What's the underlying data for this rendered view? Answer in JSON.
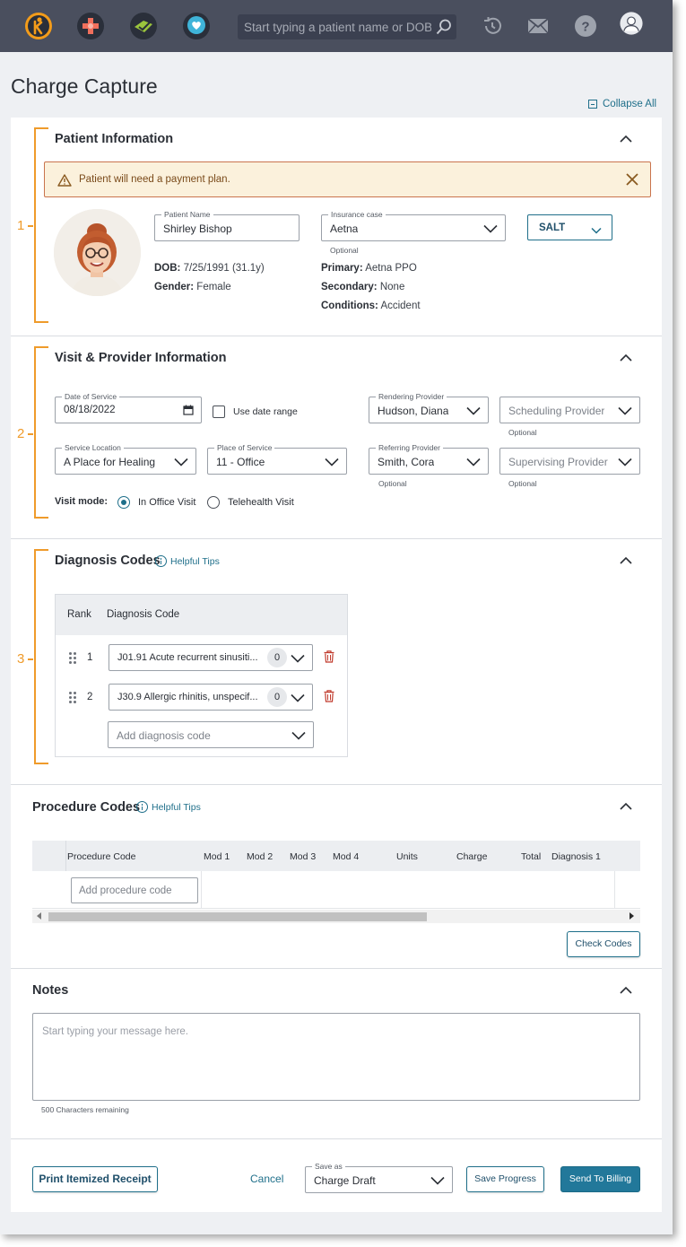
{
  "nav": {
    "search_placeholder": "Start typing a patient name or DOB",
    "apps": [
      "kareo-logo-icon",
      "medical-cross-icon",
      "checkbook-icon",
      "heart-hands-icon"
    ],
    "icons": [
      "history-icon",
      "mail-icon",
      "help-icon",
      "user-avatar-icon"
    ]
  },
  "page": {
    "title": "Charge Capture",
    "collapse_all": "Collapse All"
  },
  "brackets": [
    "1",
    "2",
    "3"
  ],
  "patient": {
    "section_title": "Patient Information",
    "alert": "Patient will need a payment plan.",
    "name_label": "Patient Name",
    "name_value": "Shirley Bishop",
    "dob_label": "DOB:",
    "dob_value": "7/25/1991 (31.1y)",
    "gender_label": "Gender:",
    "gender_value": "Female",
    "insurance_label": "Insurance case",
    "insurance_value": "Aetna",
    "insurance_optional": "Optional",
    "primary_label": "Primary:",
    "primary_value": "Aetna PPO",
    "secondary_label": "Secondary:",
    "secondary_value": "None",
    "conditions_label": "Conditions:",
    "conditions_value": "Accident",
    "salt_button": "SALT"
  },
  "visit": {
    "section_title": "Visit & Provider Information",
    "dos_label": "Date of Service",
    "dos_value": "08/18/2022",
    "use_range": "Use date range",
    "rendering_label": "Rendering Provider",
    "rendering_value": "Hudson, Diana",
    "scheduling_placeholder": "Scheduling Provider",
    "scheduling_optional": "Optional",
    "location_label": "Service Location",
    "location_value": "A Place for Healing",
    "pos_label": "Place of Service",
    "pos_value": "11 - Office",
    "referring_label": "Referring Provider",
    "referring_value": "Smith, Cora",
    "referring_optional": "Optional",
    "supervising_placeholder": "Supervising Provider",
    "supervising_optional": "Optional",
    "visit_mode_label": "Visit mode:",
    "mode_office": "In Office Visit",
    "mode_telehealth": "Telehealth Visit",
    "selected_mode": "In Office Visit"
  },
  "diagnosis": {
    "section_title": "Diagnosis Codes",
    "tips": "Helpful Tips",
    "col_rank": "Rank",
    "col_code": "Diagnosis Code",
    "rows": [
      {
        "rank": "1",
        "code": "J01.91 Acute recurrent sinusiti...",
        "count": "0"
      },
      {
        "rank": "2",
        "code": "J30.9 Allergic rhinitis, unspecif...",
        "count": "0"
      }
    ],
    "add_placeholder": "Add diagnosis code"
  },
  "procedure": {
    "section_title": "Procedure Codes",
    "tips": "Helpful Tips",
    "columns": [
      "Procedure Code",
      "Mod 1",
      "Mod 2",
      "Mod 3",
      "Mod 4",
      "Units",
      "Charge",
      "Total",
      "Diagnosis 1"
    ],
    "add_placeholder": "Add procedure code",
    "check_codes": "Check Codes"
  },
  "notes": {
    "section_title": "Notes",
    "placeholder": "Start typing your message here.",
    "chars_remaining": "500 Characters remaining"
  },
  "footer": {
    "print_receipt": "Print Itemized Receipt",
    "cancel": "Cancel",
    "save_as_label": "Save as",
    "save_as_value": "Charge Draft",
    "save_progress": "Save Progress",
    "send_billing": "Send To Billing"
  },
  "colors": {
    "nav_bg": "#4a4f5e",
    "accent": "#1f6f8a",
    "bracket": "#ef9b2b",
    "alert_bg": "#fbf1dc",
    "danger": "#c0392b"
  }
}
